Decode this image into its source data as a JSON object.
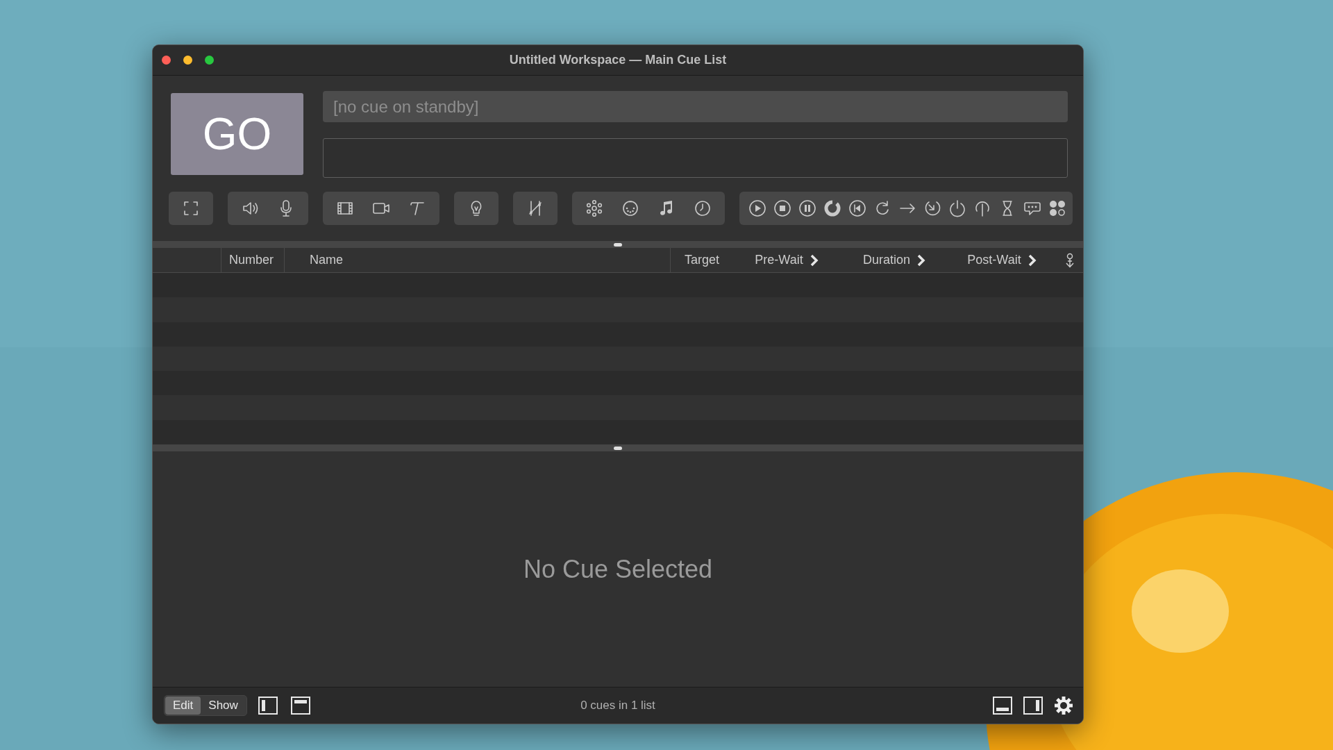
{
  "window": {
    "title": "Untitled Workspace — Main Cue List"
  },
  "go_button": {
    "label": "GO"
  },
  "standby_field": {
    "placeholder": "[no cue on standby]"
  },
  "columns": [
    {
      "label": "Number",
      "kind": "plain",
      "expandable": false
    },
    {
      "label": "Name",
      "kind": "plain",
      "expandable": false
    },
    {
      "label": "Target",
      "kind": "plain",
      "expandable": false
    },
    {
      "label": "Pre-Wait",
      "kind": "time",
      "expandable": true
    },
    {
      "label": "Duration",
      "kind": "time",
      "expandable": true
    },
    {
      "label": "Post-Wait",
      "kind": "time",
      "expandable": true
    }
  ],
  "inspector": {
    "message": "No Cue Selected"
  },
  "status_bar": {
    "modes": [
      {
        "label": "Edit",
        "selected": true
      },
      {
        "label": "Show",
        "selected": false
      }
    ],
    "summary": "0 cues in 1 list"
  }
}
